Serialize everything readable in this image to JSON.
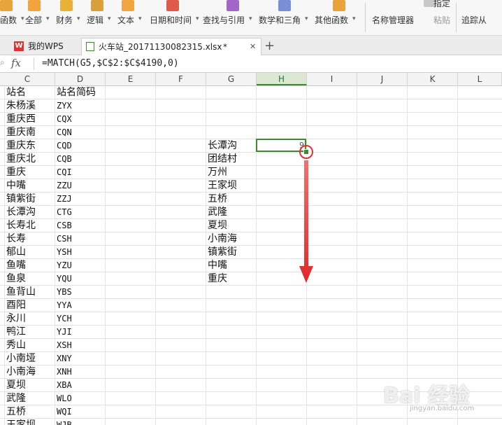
{
  "ribbon": {
    "groups": [
      {
        "label": "函数",
        "color": "#e8a33a",
        "arrow": "▾"
      },
      {
        "label": "全部",
        "color": "#f1a33d",
        "arrow": "▾"
      },
      {
        "label": "财务",
        "color": "#e8b23a",
        "arrow": "▾"
      },
      {
        "label": "逻辑",
        "color": "#d9a13b",
        "arrow": "▾"
      },
      {
        "label": "文本",
        "color": "#f0a640",
        "arrow": "▾"
      },
      {
        "label": "日期和时间",
        "color": "#e05a4c",
        "arrow": "▾"
      },
      {
        "label": "查找与引用",
        "color": "#a267c9",
        "arrow": "▾"
      },
      {
        "label": "数学和三角",
        "color": "#7a8ed6",
        "arrow": "▾"
      },
      {
        "label": "其他函数",
        "color": "#e9a23c",
        "arrow": "▾"
      }
    ],
    "name_manager": "名称管理器",
    "paste": "粘贴",
    "trace": "追踪从",
    "pointer_top": "指定"
  },
  "tabs": {
    "wps_home": "我的WPS",
    "file_name": "火车站_20171130082315.xlsx",
    "modified_mark": "*",
    "close": "✕",
    "add": "+"
  },
  "formula_bar": {
    "fx_label": "fx",
    "formula": "=MATCH(G5,$C$2:$C$4190,0)"
  },
  "columns": [
    "C",
    "D",
    "E",
    "F",
    "G",
    "H",
    "I",
    "J",
    "K",
    "L"
  ],
  "selected_column": "H",
  "columnC": [
    "站名",
    "朱杨溪",
    "重庆西",
    "重庆南",
    "重庆东",
    "重庆北",
    "重庆",
    "中嘴",
    "镇紫街",
    "长潭沟",
    "长寿北",
    "长寿",
    "郁山",
    "鱼嘴",
    "鱼泉",
    "鱼背山",
    "酉阳",
    "永川",
    "鸭江",
    "秀山",
    "小南垭",
    "小南海",
    "夏坝",
    "武隆",
    "五桥",
    "王家坝"
  ],
  "columnD": [
    "站名简码",
    "ZYX",
    "CQX",
    "CQN",
    "CQD",
    "CQB",
    "CQI",
    "ZZU",
    "ZZJ",
    "CTG",
    "CSB",
    "CSH",
    "YSH",
    "YZU",
    "YQU",
    "YBS",
    "YYA",
    "YCH",
    "YJI",
    "XSH",
    "XNY",
    "XNH",
    "XBA",
    "WLO",
    "WQI",
    "WJB"
  ],
  "columnG": [
    "长潭沟",
    "团结村",
    "万州",
    "王家坝",
    "五桥",
    "武隆",
    "夏坝",
    "小南海",
    "镇紫街",
    "中嘴",
    "重庆"
  ],
  "active_cell_value": "9",
  "colors": {
    "accent_green": "#3f8a2f",
    "annotation_red": "#e03030"
  },
  "watermark": {
    "text": "Bai 经验",
    "sub": "jingyan.baidu.com"
  }
}
